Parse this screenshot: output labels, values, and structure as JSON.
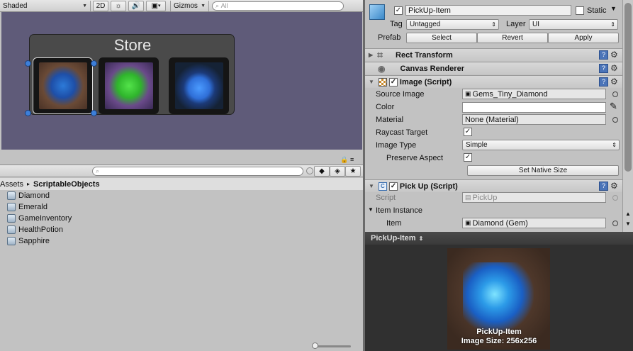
{
  "scene_toolbar": {
    "shading_mode": "Shaded",
    "mode_2d": "2D",
    "gizmos_label": "Gizmos",
    "search_placeholder": "All"
  },
  "scene": {
    "store_title": "Store",
    "slots": [
      {
        "item": "Diamond",
        "color": "#2c7ad8",
        "selected": true
      },
      {
        "item": "Emerald",
        "color": "#2fb52c",
        "selected": false
      },
      {
        "item": "HealthPotion",
        "color": "#2f6fd8",
        "selected": false
      }
    ]
  },
  "project": {
    "breadcrumb_root": "Assets",
    "breadcrumb_folder": "ScriptableObjects",
    "assets": [
      "Diamond",
      "Emerald",
      "GameInventory",
      "HealthPotion",
      "Sapphire"
    ]
  },
  "inspector": {
    "object_name": "PickUp-Item",
    "active": true,
    "static_label": "Static",
    "tag_label": "Tag",
    "tag_value": "Untagged",
    "layer_label": "Layer",
    "layer_value": "UI",
    "prefab_label": "Prefab",
    "prefab_select": "Select",
    "prefab_revert": "Revert",
    "prefab_apply": "Apply",
    "rect_transform": "Rect Transform",
    "canvas_renderer": "Canvas Renderer",
    "image_component": "Image (Script)",
    "source_image_label": "Source Image",
    "source_image_value": "Gems_Tiny_Diamond",
    "color_label": "Color",
    "material_label": "Material",
    "material_value": "None (Material)",
    "raycast_label": "Raycast Target",
    "image_type_label": "Image Type",
    "image_type_value": "Simple",
    "preserve_aspect_label": "Preserve Aspect",
    "set_native_size": "Set Native Size",
    "pickup_component": "Pick Up (Script)",
    "script_label": "Script",
    "script_value": "PickUp",
    "item_instance_label": "Item Instance",
    "item_label": "Item",
    "item_value": "Diamond (Gem)"
  },
  "preview": {
    "header": "PickUp-Item",
    "caption_name": "PickUp-Item",
    "caption_size": "Image Size: 256x256"
  }
}
